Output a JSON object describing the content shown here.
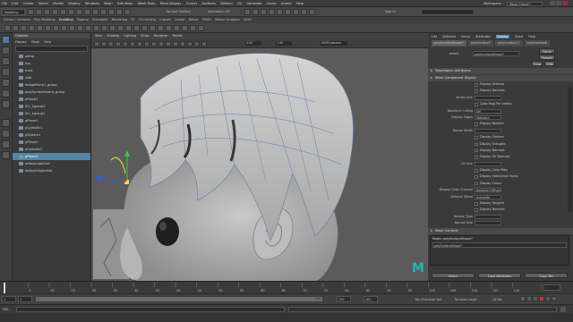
{
  "menubar": {
    "items": [
      "File",
      "Edit",
      "Create",
      "Select",
      "Modify",
      "Display",
      "Windows",
      "Mesh",
      "Edit Mesh",
      "Mesh Tools",
      "Mesh Display",
      "Curves",
      "Surfaces",
      "Deform",
      "UV",
      "Generate",
      "Cache",
      "Arnold",
      "Help"
    ],
    "workspace": "Workspace :",
    "workspace_value": "Maya Classic*"
  },
  "statusline": {
    "mode": "Modeling",
    "no_live": "No Live Surface",
    "symmetry": "Symmetry: Off",
    "sign_in": "Sign In"
  },
  "shelf": {
    "tabs": [
      "Curves / Surfaces",
      "Poly Modeling",
      "Sculpting",
      "Rigging",
      "Animation",
      "Rendering",
      "FX",
      "FX Caching",
      "Custom",
      "Arnold",
      "Bifrost",
      "MASH",
      "Motion Graphics",
      "XGen"
    ]
  },
  "outliner": {
    "title": "Outliner",
    "menu": [
      "Display",
      "Show",
      "Help"
    ],
    "items": [
      {
        "label": "persp",
        "selected": false
      },
      {
        "label": "top",
        "selected": false
      },
      {
        "label": "front",
        "selected": false
      },
      {
        "label": "side",
        "selected": false
      },
      {
        "label": "imagePlane1_group",
        "selected": false
      },
      {
        "label": "polySurfaceSetmt_group",
        "selected": false
      },
      {
        "label": "pPlane1",
        "selected": false
      },
      {
        "label": "Sl1_1group1",
        "selected": false
      },
      {
        "label": "Sl1_1group2",
        "selected": false
      },
      {
        "label": "pPlane1",
        "selected": false
      },
      {
        "label": "pCylinder1",
        "selected": false
      },
      {
        "label": "pSphere1",
        "selected": false
      },
      {
        "label": "pPlane2",
        "selected": false
      },
      {
        "label": "pCylinder2",
        "selected": false
      },
      {
        "label": "pPlane3",
        "selected": true
      },
      {
        "label": "defaultLightSet",
        "selected": false
      },
      {
        "label": "defaultObjectSet",
        "selected": false
      }
    ]
  },
  "viewport": {
    "menu": [
      "View",
      "Shading",
      "Lighting",
      "Show",
      "Renderer",
      "Panels"
    ],
    "colorspace": "sRGB gamma",
    "field_a": "0.00",
    "field_b": "1.00"
  },
  "attribute_editor": {
    "tabs": [
      "List",
      "Selected",
      "Focus",
      "Attributes",
      "Display",
      "Show",
      "Help"
    ],
    "node_tabs": [
      "polySurfaceShape7",
      "polySurface7",
      "polySurface17",
      "polySurface8"
    ],
    "mesh_label": "mesh:",
    "mesh_value": "polySurfaceShape7",
    "focus_btn": "Focus",
    "presets_btn": "Presets",
    "show_btn": "Show",
    "hide_btn": "Hide",
    "sections": {
      "tessellation": "Tessellation Attributes",
      "mesh_display": "Mesh Component Display",
      "mesh_controls": "Mesh Controls"
    },
    "rows": [
      {
        "label": "",
        "check": "Display Vertices",
        "type": "check"
      },
      {
        "label": "",
        "check": "Display Normals",
        "type": "check"
      },
      {
        "label": "Vertex Size",
        "check": "",
        "type": "field",
        "value": ""
      },
      {
        "label": "",
        "check": "Color Map Per Vertex",
        "type": "check"
      },
      {
        "label": "Backface Culling",
        "check": "",
        "type": "field",
        "value": "Off"
      },
      {
        "label": "Display Edges",
        "check": "",
        "type": "field",
        "value": "Standard"
      },
      {
        "label": "",
        "check": "Display Borders",
        "type": "check"
      },
      {
        "label": "Border Width",
        "check": "",
        "type": "field",
        "value": ""
      },
      {
        "label": "",
        "check": "Display Centers",
        "type": "check"
      },
      {
        "label": "",
        "check": "Display Triangles",
        "type": "check"
      },
      {
        "label": "",
        "check": "Display Normals",
        "type": "check"
      },
      {
        "label": "",
        "check": "Display UV Normals",
        "type": "check"
      },
      {
        "label": "UV Size",
        "check": "",
        "type": "field",
        "value": ""
      },
      {
        "label": "",
        "check": "Display Color Map",
        "type": "check"
      },
      {
        "label": "",
        "check": "Display Interactive Faces",
        "type": "check"
      },
      {
        "label": "",
        "check": "Display Colors",
        "type": "check"
      },
      {
        "label": "Display Color Channel",
        "check": "",
        "type": "field",
        "value": "Ambient+Diffuse"
      },
      {
        "label": "Material Blend",
        "check": "",
        "type": "field",
        "value": "overwrite"
      },
      {
        "label": "",
        "check": "Display Tangent",
        "type": "check"
      },
      {
        "label": "",
        "check": "Display Normals",
        "type": "check"
      },
      {
        "label": "Normal Type",
        "check": "",
        "type": "field",
        "value": ""
      },
      {
        "label": "Normal Size",
        "check": "",
        "type": "field",
        "value": ""
      }
    ],
    "notes_label": "Notes: polySurfaceShape7",
    "notes_value": "polySurfaceShape7",
    "buttons": [
      "Select",
      "Load Attributes",
      "Copy Tab"
    ]
  },
  "timeline": {
    "ticks": [
      "5",
      "10",
      "15",
      "20",
      "25",
      "30",
      "35",
      "40",
      "45",
      "50",
      "55",
      "60",
      "65",
      "70",
      "75",
      "80",
      "85",
      "90",
      "95",
      "100",
      "105",
      "110",
      "115",
      "120"
    ],
    "current_frame": "1"
  },
  "range": {
    "start": "1",
    "start2": "1",
    "range_start": "1",
    "range_end": "120",
    "end": "120",
    "end2": "200",
    "char_set": "No Character Set",
    "anim_layer": "No Anim Layer",
    "fps": "24 fps"
  },
  "cmdline": {
    "lang": "MEL"
  }
}
